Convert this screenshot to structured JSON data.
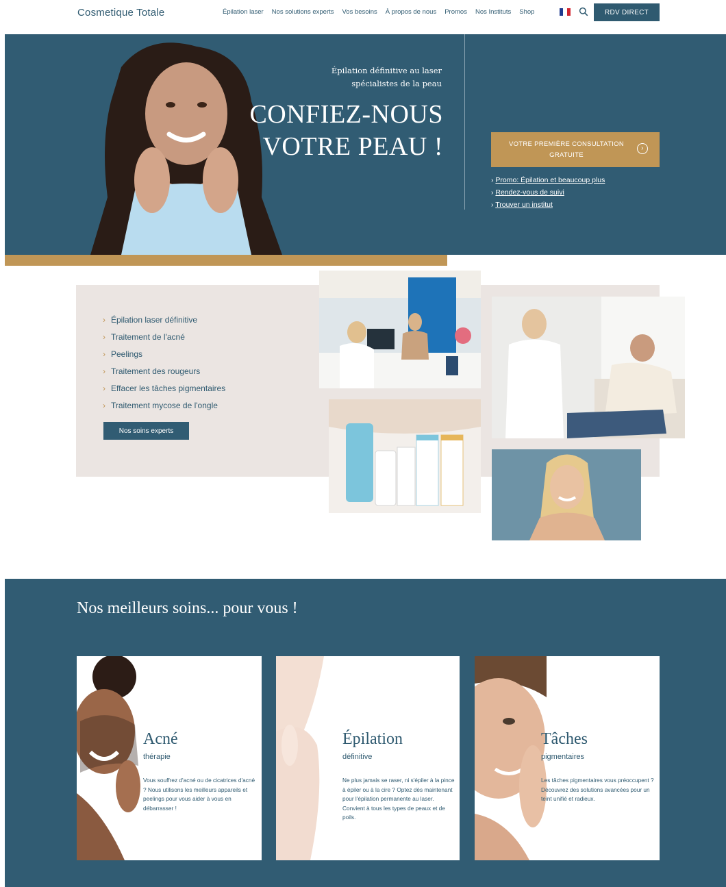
{
  "header": {
    "logo": "Cosmetique Totale",
    "nav": [
      "Épilation laser",
      "Nos solutions experts",
      "Vos besoins",
      "À propos de nous",
      "Promos",
      "Nos Instituts",
      "Shop"
    ],
    "flag_colors": [
      "#1f3b8f",
      "#ffffff",
      "#d22630"
    ],
    "search_icon": "search-icon",
    "rdv_button": "RDV DIRECT"
  },
  "hero": {
    "subtitle_line1": "Épilation définitive au laser",
    "subtitle_line2": "spécialistes de la peau",
    "title_line1": "CONFIEZ-NOUS",
    "title_line2": "VOTRE PEAU !",
    "cta_line1": "VOTRE PREMIÈRE CONSULTATION",
    "cta_line2": "GRATUITE",
    "cta_icon": "chevron-right-circle-icon",
    "links": [
      "Promo: Épilation et beaucoup plus",
      "Rendez-vous de suivi",
      "Trouver un institut"
    ]
  },
  "services": {
    "items": [
      "Épilation laser définitive",
      "Traitement de l'acné",
      "Peelings",
      "Traitement des rougeurs",
      "Effacer les tâches pigmentaires",
      "Traitement mycose de l'ongle"
    ],
    "button": "Nos soins experts"
  },
  "best": {
    "title": "Nos meilleurs soins... pour vous !",
    "cards": [
      {
        "title": "Acné",
        "subtitle": "thérapie",
        "desc": "Vous souffrez d'acné ou de cicatrices d'acné ? Nous utilisons les meilleurs appareils et peelings pour vous aider à vous en débarrasser !"
      },
      {
        "title": "Épilation",
        "subtitle": "définitive",
        "desc": "Ne plus jamais se raser, ni s'épiler à la pince à épiler ou à la cire ? Optez dès maintenant pour l'épilation permanente au laser. Convient à tous les types de peaux et de poils."
      },
      {
        "title": "Tâches",
        "subtitle": "pigmentaires",
        "desc": "Les tâches pigmentaires vous préoccupent ? Découvrez des solutions avancées pour un teint unifié et radieux."
      }
    ]
  },
  "colors": {
    "brand_blue": "#315c73",
    "gold": "#c09656",
    "panel": "#ebe5e2"
  }
}
